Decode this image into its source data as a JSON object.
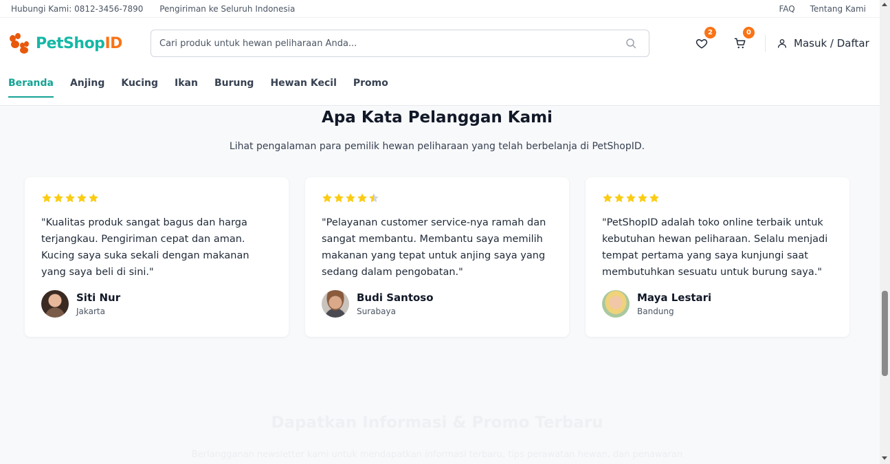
{
  "topbar": {
    "contact": "Hubungi Kami: 0812-3456-7890",
    "shipping": "Pengiriman ke Seluruh Indonesia",
    "faq": "FAQ",
    "about": "Tentang Kami"
  },
  "brand": {
    "name_main": "PetShop",
    "name_accent": "ID",
    "primary_color": "#14b8a6",
    "accent_color": "#f97316"
  },
  "search": {
    "placeholder": "Cari produk untuk hewan peliharaan Anda..."
  },
  "wishlist": {
    "count": "2"
  },
  "cart": {
    "count": "0"
  },
  "account": {
    "label": "Masuk / Daftar"
  },
  "nav": {
    "items": [
      "Beranda",
      "Anjing",
      "Kucing",
      "Ikan",
      "Burung",
      "Hewan Kecil",
      "Promo"
    ],
    "active": "Beranda"
  },
  "testimonials": {
    "title": "Apa Kata Pelanggan Kami",
    "subtitle": "Lihat pengalaman para pemilik hewan peliharaan yang telah berbelanja di PetShopID.",
    "items": [
      {
        "rating": 5,
        "quote": "\"Kualitas produk sangat bagus dan harga terjangkau. Pengiriman cepat dan aman. Kucing saya suka sekali dengan makanan yang saya beli di sini.\"",
        "name": "Siti Nur",
        "city": "Jakarta"
      },
      {
        "rating": 4.5,
        "quote": "\"Pelayanan customer service-nya ramah dan sangat membantu. Membantu saya memilih makanan yang tepat untuk anjing saya yang sedang dalam pengobatan.\"",
        "name": "Budi Santoso",
        "city": "Surabaya"
      },
      {
        "rating": 5,
        "quote": "\"PetShopID adalah toko online terbaik untuk kebutuhan hewan peliharaan. Selalu menjadi tempat pertama yang saya kunjungi saat membutuhkan sesuatu untuk burung saya.\"",
        "name": "Maya Lestari",
        "city": "Bandung"
      }
    ]
  },
  "newsletter": {
    "title": "Dapatkan Informasi & Promo Terbaru",
    "subtitle": "Berlangganan newsletter kami untuk mendapatkan informasi terbaru, tips perawatan hewan, dan penawaran"
  }
}
